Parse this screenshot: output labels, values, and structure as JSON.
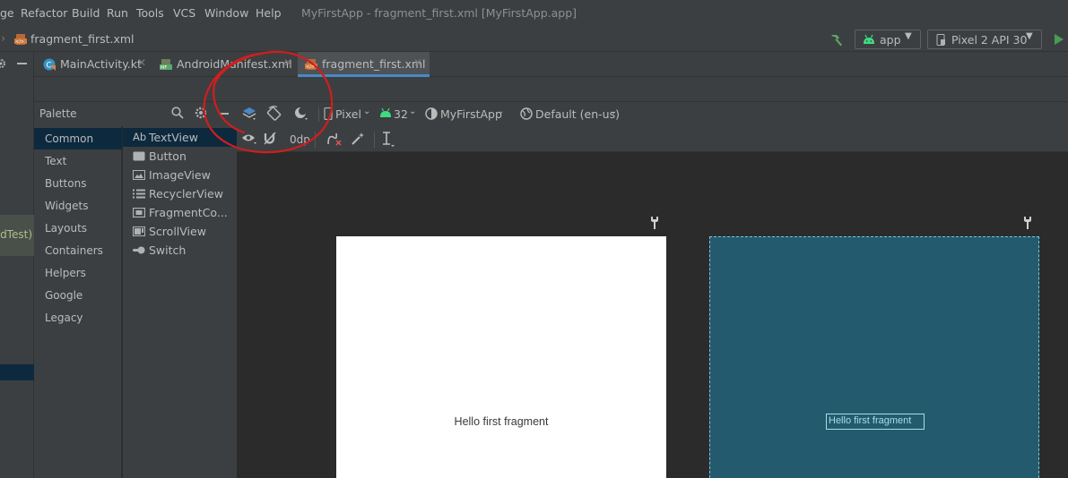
{
  "menu": [
    "ge",
    "Refactor",
    "Build",
    "Run",
    "Tools",
    "VCS",
    "Window",
    "Help"
  ],
  "window_title": "MyFirstApp - fragment_first.xml [MyFirstApp.app]",
  "breadcrumb": {
    "file": "fragment_first.xml"
  },
  "run_config": "app",
  "device": "Pixel 2 API 30",
  "tabs": [
    {
      "label": "MainActivity.kt"
    },
    {
      "label": "AndroidManifest.xml"
    },
    {
      "label": "fragment_first.xml"
    }
  ],
  "project_panel": {
    "android_test": "oidTest)"
  },
  "palette": {
    "title": "Palette",
    "categories": [
      "Common",
      "Text",
      "Buttons",
      "Widgets",
      "Layouts",
      "Containers",
      "Helpers",
      "Google",
      "Legacy"
    ],
    "items": [
      "TextView",
      "Button",
      "ImageView",
      "RecyclerView",
      "FragmentCo...",
      "ScrollView",
      "Switch"
    ],
    "textview_prefix": "Ab"
  },
  "toolbar": {
    "device": "Pixel",
    "api": "32",
    "theme": "MyFirstApp",
    "locale": "Default (en-us)",
    "margin": "0dp"
  },
  "canvas": {
    "design_text": "Hello first fragment",
    "blueprint_text": "Hello first fragment"
  },
  "colors": {
    "accent": "#4a88c7",
    "blueprint": "#245a6e",
    "annotation": "#d01e1e",
    "run": "#499c54",
    "android": "#3ddc84"
  }
}
